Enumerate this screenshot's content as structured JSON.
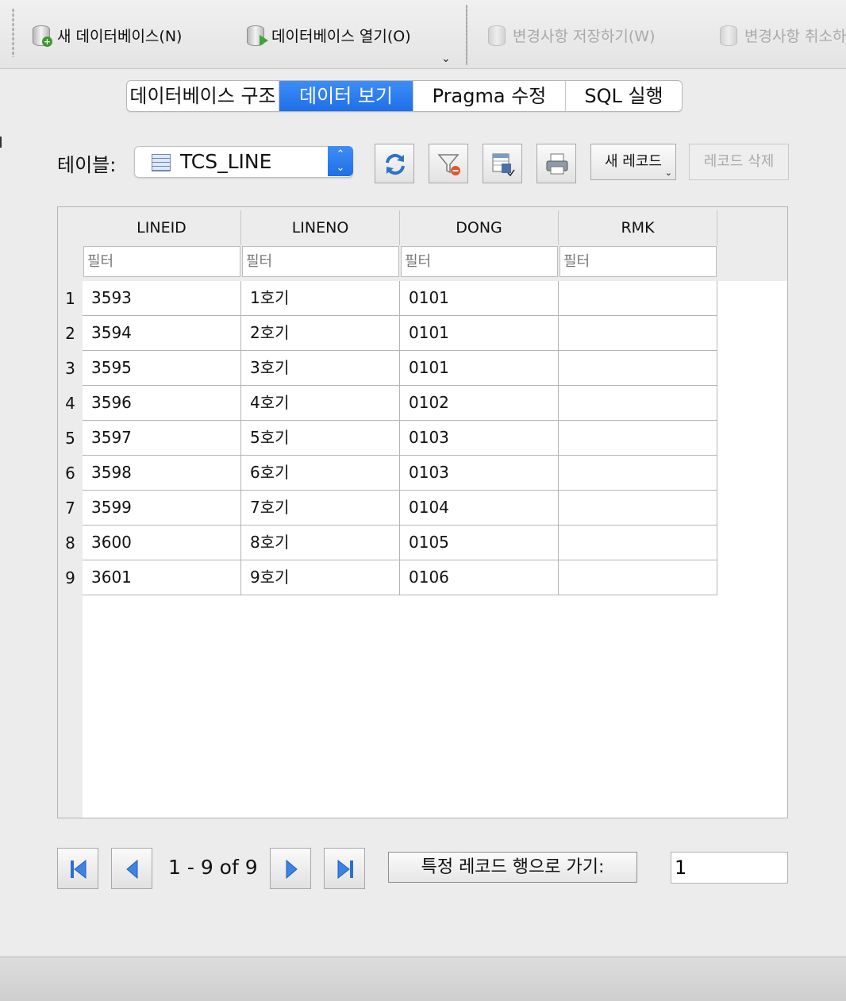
{
  "toolbar": {
    "new_db": "새 데이터베이스(N)",
    "open_db": "데이터베이스 열기(O)",
    "save_changes": "변경사항 저장하기(W)",
    "revert_changes": "변경사항 취소하",
    "more_icon": "chevron-down-icon"
  },
  "tabs": [
    {
      "label": "데이터베이스 구조",
      "active": false
    },
    {
      "label": "데이터 보기",
      "active": true
    },
    {
      "label": "Pragma 수정",
      "active": false
    },
    {
      "label": "SQL 실행",
      "active": false
    }
  ],
  "browse": {
    "table_label": "테이블:",
    "table_value": "TCS_LINE",
    "new_record": "새 레코드",
    "delete_record": "레코드 삭제",
    "icons": [
      "refresh-icon",
      "clear-filter-icon",
      "save-table-icon",
      "print-icon"
    ]
  },
  "grid": {
    "columns": [
      "LINEID",
      "LINENO",
      "DONG",
      "RMK"
    ],
    "filter_placeholder": "필터",
    "rows": [
      [
        "1",
        "3593",
        "1호기",
        "0101",
        ""
      ],
      [
        "2",
        "3594",
        "2호기",
        "0101",
        ""
      ],
      [
        "3",
        "3595",
        "3호기",
        "0101",
        ""
      ],
      [
        "4",
        "3596",
        "4호기",
        "0102",
        ""
      ],
      [
        "5",
        "3597",
        "5호기",
        "0103",
        ""
      ],
      [
        "6",
        "3598",
        "6호기",
        "0103",
        ""
      ],
      [
        "7",
        "3599",
        "7호기",
        "0104",
        ""
      ],
      [
        "8",
        "3600",
        "8호기",
        "0105",
        ""
      ],
      [
        "9",
        "3601",
        "9호기",
        "0106",
        ""
      ]
    ]
  },
  "pagination": {
    "range": "1 - 9 of 9",
    "goto_label": "특정 레코드 행으로 가기:",
    "goto_value": "1"
  },
  "colors": {
    "accent": "#2a7cf0",
    "toolbar_bg": "#e8e8e8",
    "disabled_text": "#a9a9a9"
  }
}
